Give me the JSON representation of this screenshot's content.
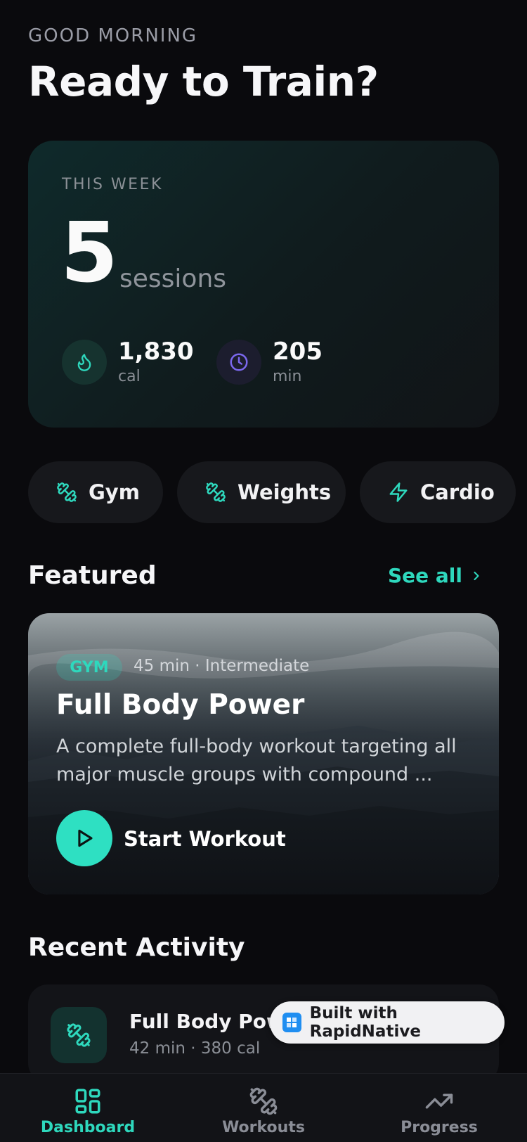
{
  "header": {
    "greeting": "GOOD MORNING",
    "title": "Ready to Train?"
  },
  "week": {
    "label": "THIS WEEK",
    "sessions_value": "5",
    "sessions_unit": "sessions",
    "stats": [
      {
        "icon": "flame-icon",
        "value": "1,830",
        "unit": "cal",
        "color": "#2ed8bd"
      },
      {
        "icon": "clock-icon",
        "value": "205",
        "unit": "min",
        "color": "#7b68ee"
      }
    ]
  },
  "categories": [
    {
      "icon": "dumbbell-icon",
      "label": "Gym"
    },
    {
      "icon": "dumbbell-icon",
      "label": "Weights"
    },
    {
      "icon": "bolt-icon",
      "label": "Cardio"
    }
  ],
  "featured": {
    "section_title": "Featured",
    "see_all": "See all",
    "badge": "GYM",
    "meta": "45 min  ·  Intermediate",
    "title": "Full Body Power",
    "description": "A complete full-body workout targeting all major muscle groups with compound ...",
    "start_label": "Start Workout"
  },
  "recent": {
    "section_title": "Recent Activity",
    "items": [
      {
        "title": "Full Body Power",
        "subtitle": "42 min · 380 cal"
      }
    ]
  },
  "built_with": "Built with RapidNative",
  "tabs": [
    {
      "label": "Dashboard",
      "icon": "grid-icon",
      "active": true
    },
    {
      "label": "Workouts",
      "icon": "dumbbell-icon",
      "active": false
    },
    {
      "label": "Progress",
      "icon": "trending-up-icon",
      "active": false
    }
  ],
  "colors": {
    "accent": "#2ed8bd",
    "background": "#0a0a0d",
    "inactive": "#8a8d96"
  }
}
